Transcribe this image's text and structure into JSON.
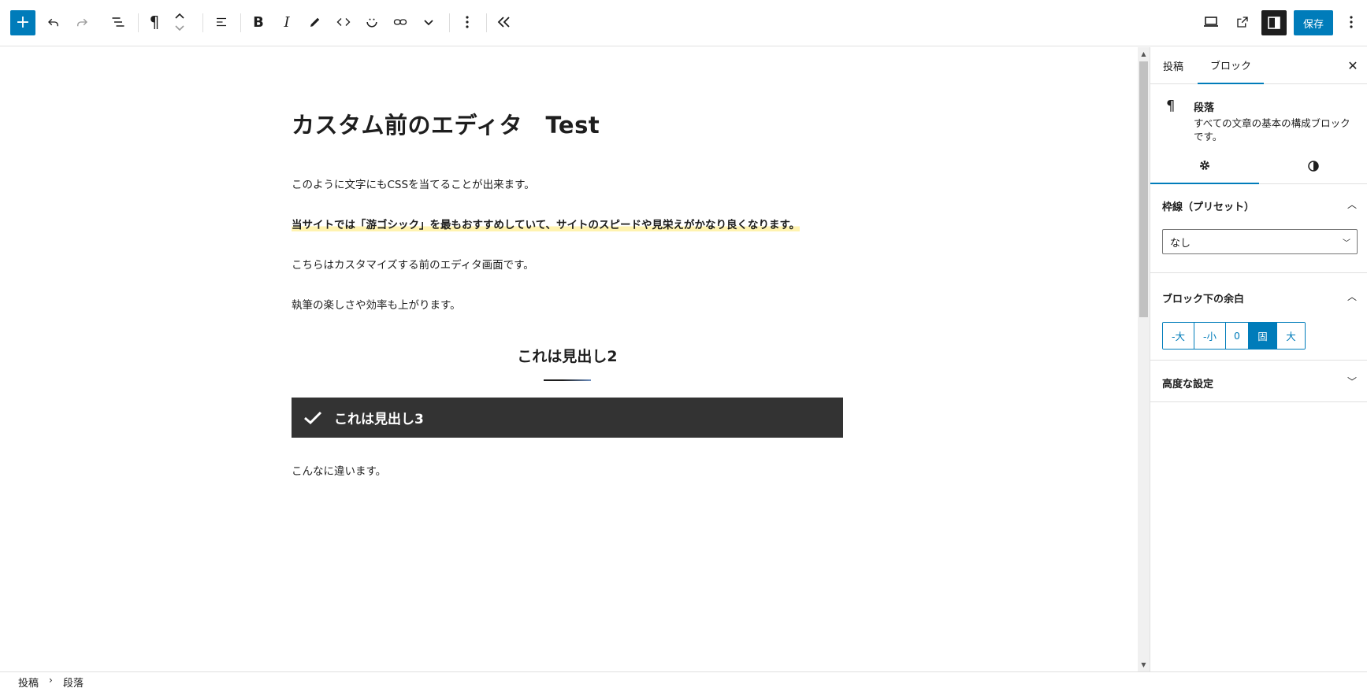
{
  "toolbar": {
    "add_label": "+",
    "save_label": "保存"
  },
  "post": {
    "title": "カスタム前のエディタ　Test",
    "paragraphs": [
      "このように文字にもCSSを当てることが出来ます。",
      "当サイトでは「游ゴシック」を最もおすすめしていて、サイトのスピードや見栄えがかなり良くなります。",
      "こちらはカスタマイズする前のエディタ画面です。",
      "執筆の楽しさや効率も上がります。"
    ],
    "heading2": "これは見出し2",
    "heading3": "これは見出し3",
    "last_paragraph": "こんなに違います。"
  },
  "sidebar": {
    "tabs": [
      "投稿",
      "ブロック"
    ],
    "active_tab": "ブロック",
    "block": {
      "icon": "¶",
      "title": "段落",
      "description": "すべての文章の基本の構成ブロックです。"
    },
    "border_panel": {
      "title": "枠線（プリセット）",
      "select_value": "なし"
    },
    "spacing_panel": {
      "title": "ブロック下の余白",
      "options": [
        "-大",
        "-小",
        "0",
        "固",
        "大"
      ],
      "selected": "固"
    },
    "advanced_panel": {
      "title": "高度な設定"
    }
  },
  "breadcrumb": [
    "投稿",
    "段落"
  ],
  "colors": {
    "accent": "#007cba",
    "heading3_bg": "#333333",
    "marker": "#fff3b0"
  }
}
